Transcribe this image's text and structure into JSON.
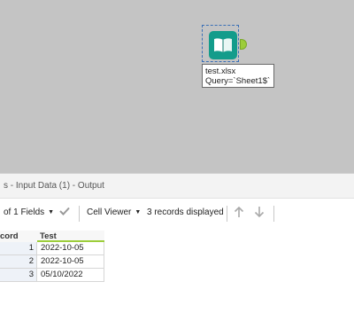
{
  "canvas": {
    "tool": {
      "icon": "book-icon",
      "file_name": "test.xlsx",
      "query": "Query=`Sheet1$`",
      "accent_color": "#139c8b",
      "anchor_color": "#9ccd3a"
    }
  },
  "results": {
    "title": "s - Input Data (1) - Output"
  },
  "toolbar": {
    "fields_selector": "of 1 Fields",
    "check_icon": "check-icon",
    "viewer_selector": "Cell Viewer",
    "records_status": "3 records displayed",
    "nav_up_icon": "arrow-up-icon",
    "nav_down_icon": "arrow-down-icon"
  },
  "grid": {
    "columns": [
      "cord",
      "Test"
    ],
    "rows": [
      {
        "record": "1",
        "test": "2022-10-05"
      },
      {
        "record": "2",
        "test": "2022-10-05"
      },
      {
        "record": "3",
        "test": "05/10/2022"
      }
    ]
  }
}
